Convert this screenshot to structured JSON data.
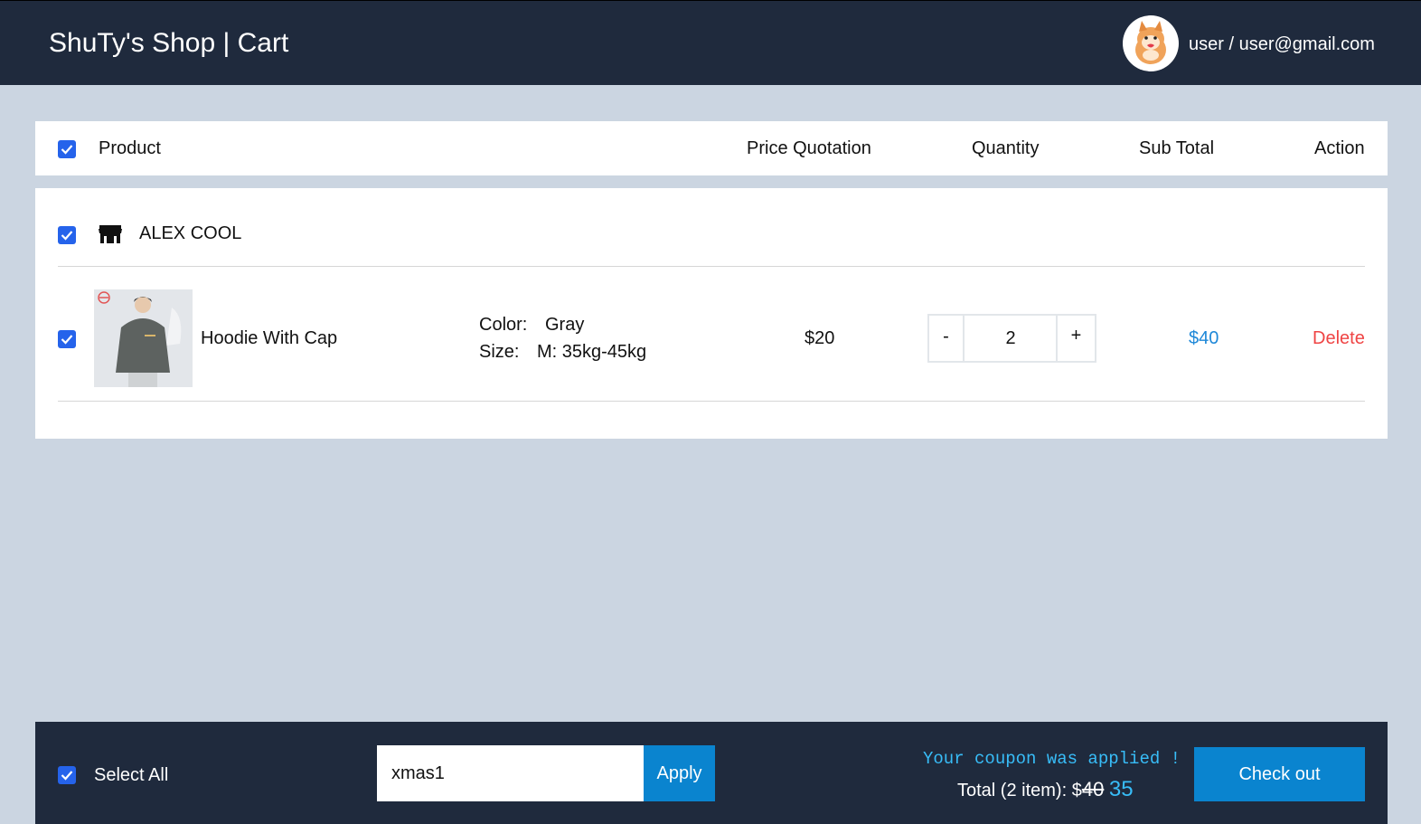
{
  "header": {
    "title": "ShuTy's Shop | Cart",
    "user": "user / user@gmail.com"
  },
  "table_header": {
    "product": "Product",
    "price": "Price Quotation",
    "quantity": "Quantity",
    "subtotal": "Sub Total",
    "action": "Action"
  },
  "shop": {
    "name": "ALEX COOL",
    "item": {
      "name": "Hoodie With Cap",
      "color_label": "Color:",
      "color_value": "Gray",
      "size_label": "Size:",
      "size_value": "M: 35kg-45kg",
      "price": "$20",
      "qty_minus": "-",
      "quantity": "2",
      "qty_plus": "+",
      "subtotal": "$40",
      "delete": "Delete"
    }
  },
  "footer": {
    "select_all": "Select All",
    "coupon_value": "xmas1",
    "apply": "Apply",
    "applied_msg": "Your coupon was applied !",
    "total_label": "Total (2 item): $",
    "old_total": "40",
    "new_total": "35",
    "checkout": "Check out"
  },
  "colors": {
    "nav_bg": "#1f2a3d",
    "page_bg": "#cbd5e1",
    "checkbox": "#2563eb",
    "accent": "#0a84cf",
    "link_blue": "#1e88d8",
    "danger": "#ef4444"
  }
}
